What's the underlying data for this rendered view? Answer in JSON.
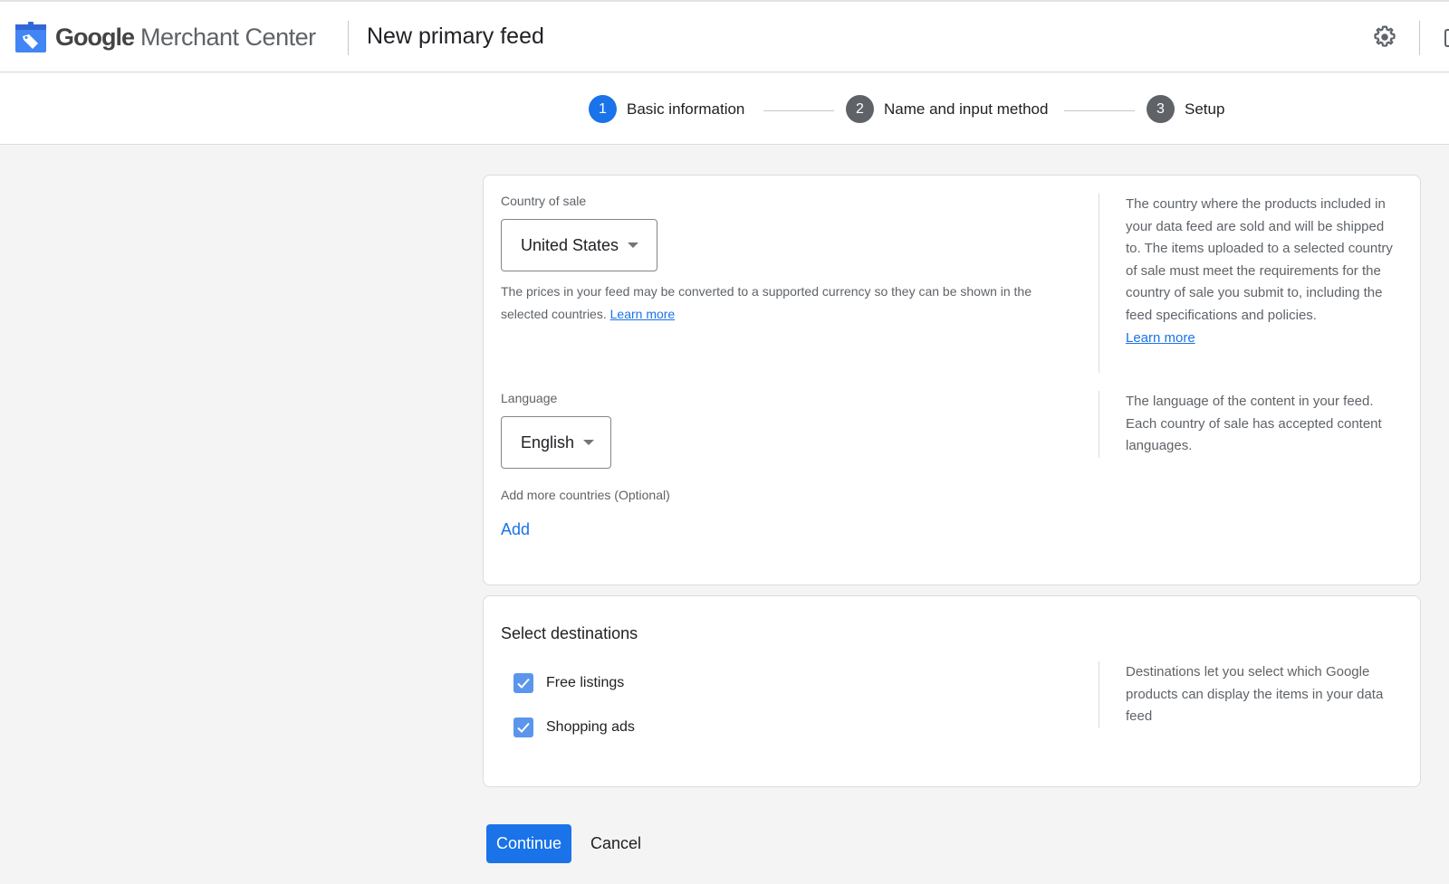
{
  "header": {
    "brand_google": "Google",
    "brand_product": " Merchant Center",
    "page_title": "New primary feed",
    "icons": {
      "logo": "merchant-center-tag-logo",
      "settings": "gear-icon"
    }
  },
  "stepper": {
    "steps": [
      {
        "number": "1",
        "label": "Basic information",
        "state": "active"
      },
      {
        "number": "2",
        "label": "Name and input method",
        "state": "inactive"
      },
      {
        "number": "3",
        "label": "Setup",
        "state": "inactive"
      }
    ]
  },
  "basic_info": {
    "country": {
      "label": "Country of sale",
      "value": "United States",
      "hint": "The prices in your feed may be converted to a supported currency so they can be shown in the selected countries.",
      "hint_link": "Learn more",
      "help_text": "The country where the products included in your data feed are sold and will be shipped to. The items uploaded to a selected country of sale must meet the requirements for the country of sale you submit to, including the feed specifications and policies.",
      "help_link": "Learn more"
    },
    "language": {
      "label": "Language",
      "value": "English",
      "help_text": "The language of the content in your feed. Each country of sale has accepted content languages."
    },
    "more_countries": {
      "label": "Add more countries (Optional)",
      "add_label": "Add"
    }
  },
  "destinations": {
    "title": "Select destinations",
    "options": [
      {
        "label": "Free listings",
        "checked": true
      },
      {
        "label": "Shopping ads",
        "checked": true
      }
    ],
    "help_text": "Destinations let you select which Google products can display the items in your data feed"
  },
  "actions": {
    "continue_label": "Continue",
    "cancel_label": "Cancel"
  },
  "colors": {
    "accent": "#1a73e8",
    "checkbox": "#5b95ec",
    "inactive_step": "#5f6368",
    "background": "#f4f4f4"
  }
}
